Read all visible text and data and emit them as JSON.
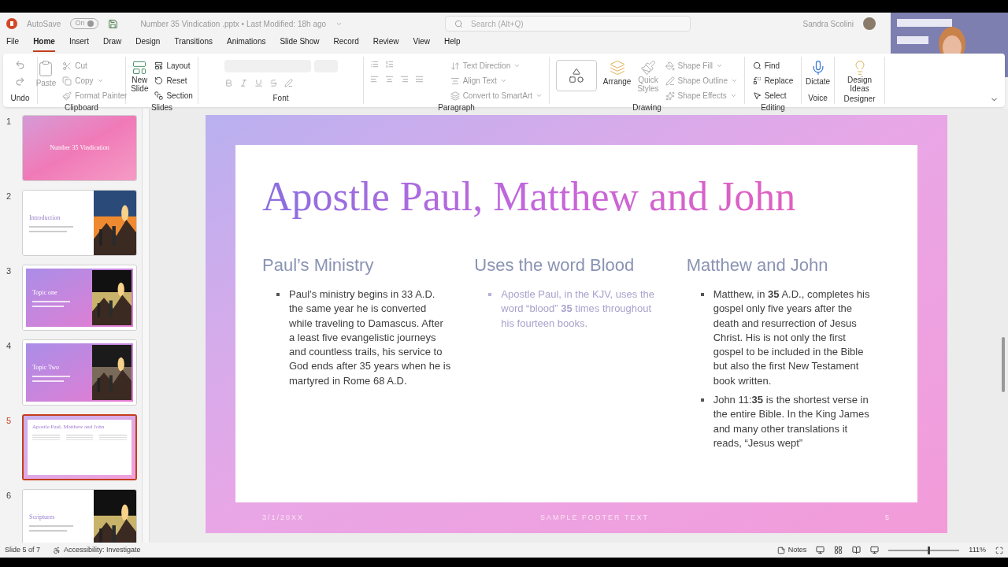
{
  "title_bar": {
    "autosave_label": "AutoSave",
    "autosave_toggle": "On",
    "file_name": "Number 35 Vindication .pptx • Last Modified: 18h ago",
    "search_placeholder": "Search (Alt+Q)",
    "user_name": "Sandra Scolini"
  },
  "menu_tabs": [
    {
      "label": "File",
      "selected": false
    },
    {
      "label": "Home",
      "selected": true
    },
    {
      "label": "Insert",
      "selected": false
    },
    {
      "label": "Draw",
      "selected": false
    },
    {
      "label": "Design",
      "selected": false
    },
    {
      "label": "Transitions",
      "selected": false
    },
    {
      "label": "Animations",
      "selected": false
    },
    {
      "label": "Slide Show",
      "selected": false
    },
    {
      "label": "Record",
      "selected": false
    },
    {
      "label": "Review",
      "selected": false
    },
    {
      "label": "View",
      "selected": false
    },
    {
      "label": "Help",
      "selected": false
    }
  ],
  "ribbon": {
    "undo": {
      "label": "Undo"
    },
    "clipboard": {
      "label": "Clipboard",
      "paste": "Paste",
      "cut": "Cut",
      "copy": "Copy",
      "format_painter": "Format Painter"
    },
    "slides": {
      "label": "Slides",
      "new_slide": "New Slide",
      "layout": "Layout",
      "reset": "Reset",
      "section": "Section"
    },
    "font": {
      "label": "Font"
    },
    "paragraph": {
      "label": "Paragraph",
      "text_direction": "Text Direction",
      "align_text": "Align Text",
      "convert": "Convert to SmartArt"
    },
    "drawing": {
      "label": "Drawing",
      "arrange": "Arrange",
      "quick_styles": "Quick Styles",
      "shape_fill": "Shape Fill",
      "shape_outline": "Shape Outline",
      "shape_effects": "Shape Effects"
    },
    "editing": {
      "label": "Editing",
      "find": "Find",
      "replace": "Replace",
      "select": "Select"
    },
    "voice": {
      "label": "Voice",
      "dictate": "Dictate"
    },
    "designer": {
      "label": "Designer",
      "design_ideas": "Design Ideas"
    }
  },
  "thumbnails": [
    {
      "number": "1",
      "kind": "title",
      "title": "Number 35 Vindication",
      "selected": false
    },
    {
      "number": "2",
      "kind": "intro",
      "title": "Introduction",
      "selected": false
    },
    {
      "number": "3",
      "kind": "topic",
      "title": "Topic one",
      "selected": false
    },
    {
      "number": "4",
      "kind": "topic",
      "title": "Topic Two",
      "selected": false
    },
    {
      "number": "5",
      "kind": "content",
      "title": "Apostle Paul, Matthew and John",
      "selected": true
    },
    {
      "number": "6",
      "kind": "intro",
      "title": "Scriptures",
      "selected": false
    }
  ],
  "slide": {
    "title": "Apostle Paul, Matthew and John",
    "columns": [
      {
        "heading": "Paul’s Ministry",
        "faded": false,
        "bullets": [
          "Paul’s ministry begins in 33 A.D. the same year he is converted while traveling to Damascus. After a least five evangelistic journeys and countless trails, his service to God ends after 35 years when he is martyred in Rome 68 A.D."
        ]
      },
      {
        "heading": "Uses the word Blood",
        "faded": true,
        "bullets": [
          "Apostle Paul, in the KJV, uses the word “blood” **35** times throughout his fourteen books."
        ]
      },
      {
        "heading": "Matthew and John",
        "faded": false,
        "bullets": [
          "Matthew, in **35** A.D., completes his gospel only five years after the death and resurrection of Jesus Christ.  His is not only the first gospel to be included in the Bible but also the first New Testament book written.",
          "John 11:**35** is the shortest verse in the entire Bible.  In the King James and many other translations it reads, “Jesus wept”"
        ]
      }
    ],
    "footer": {
      "date": "3/1/20XX",
      "text": "SAMPLE FOOTER TEXT",
      "page": "5"
    }
  },
  "status_bar": {
    "slide_count": "Slide 5 of 7",
    "accessibility": "Accessibility: Investigate",
    "notes": "Notes",
    "zoom": {
      "level": 0.55
    },
    "zoom_percent": "111%"
  }
}
